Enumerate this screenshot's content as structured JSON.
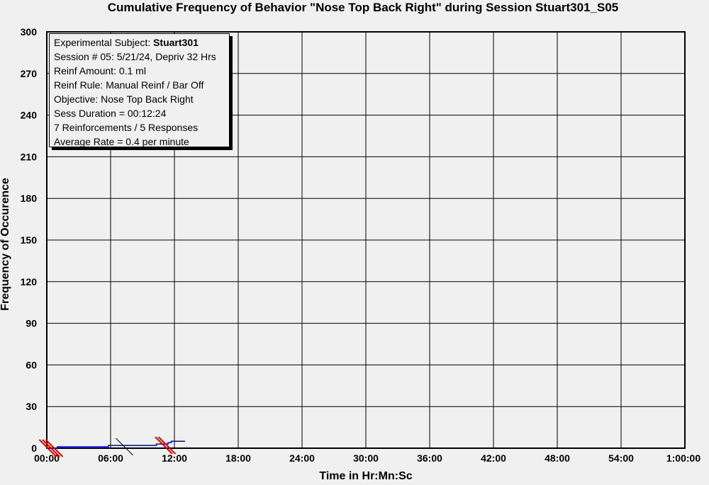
{
  "chart_data": {
    "type": "line",
    "title": "Cumulative Frequency of Behavior \"Nose Top Back Right\" during Session Stuart301_S05",
    "xlabel": "Time in Hr:Mn:Sc",
    "ylabel": "Frequency of Occurence",
    "x_unit": "minutes",
    "xlim": [
      0,
      60
    ],
    "ylim": [
      0,
      300
    ],
    "x_ticks": [
      0,
      6,
      12,
      18,
      24,
      30,
      36,
      42,
      48,
      54,
      60
    ],
    "x_tick_labels": [
      "00:00",
      "06:00",
      "12:00",
      "18:00",
      "24:00",
      "30:00",
      "36:00",
      "42:00",
      "48:00",
      "54:00",
      "1:00:00"
    ],
    "y_ticks": [
      0,
      30,
      60,
      90,
      120,
      150,
      180,
      210,
      240,
      270,
      300
    ],
    "y_tick_labels": [
      "0",
      "30",
      "60",
      "90",
      "120",
      "150",
      "180",
      "210",
      "240",
      "270",
      "300"
    ],
    "grid": true,
    "series": [
      {
        "color": "#0000cc",
        "points": [
          [
            0.0,
            0
          ],
          [
            1.0,
            0
          ],
          [
            1.0,
            1
          ],
          [
            5.8,
            1
          ],
          [
            5.8,
            2
          ],
          [
            10.3,
            2
          ],
          [
            10.3,
            3
          ],
          [
            11.4,
            3
          ],
          [
            11.4,
            4
          ],
          [
            11.7,
            4
          ],
          [
            11.7,
            5
          ],
          [
            13.0,
            5
          ]
        ]
      }
    ],
    "markers": [
      {
        "x": 0.1,
        "y": 0,
        "color": "#cc0000"
      },
      {
        "x": 0.4,
        "y": 0,
        "color": "#cc0000"
      },
      {
        "x": 0.7,
        "y": 0,
        "color": "#cc0000"
      },
      {
        "x": 7.3,
        "y": 1,
        "color": "#000000"
      },
      {
        "x": 11.0,
        "y": 2,
        "color": "#cc0000"
      },
      {
        "x": 11.3,
        "y": 2,
        "color": "#cc0000"
      }
    ]
  },
  "info": {
    "subject_label": "Experimental Subject:",
    "subject_value": "Stuart301",
    "session": "Session # 05: 5/21/24, Depriv 32 Hrs",
    "reinf_amount": "Reinf Amount: 0.1 ml",
    "reinf_rule": "Reinf Rule: Manual Reinf / Bar Off",
    "objective": "Objective: Nose Top Back Right",
    "duration": "Sess Duration = 00:12:24",
    "counts": "7 Reinforcements / 5 Responses",
    "rate": "Average Rate = 0.4 per minute"
  }
}
